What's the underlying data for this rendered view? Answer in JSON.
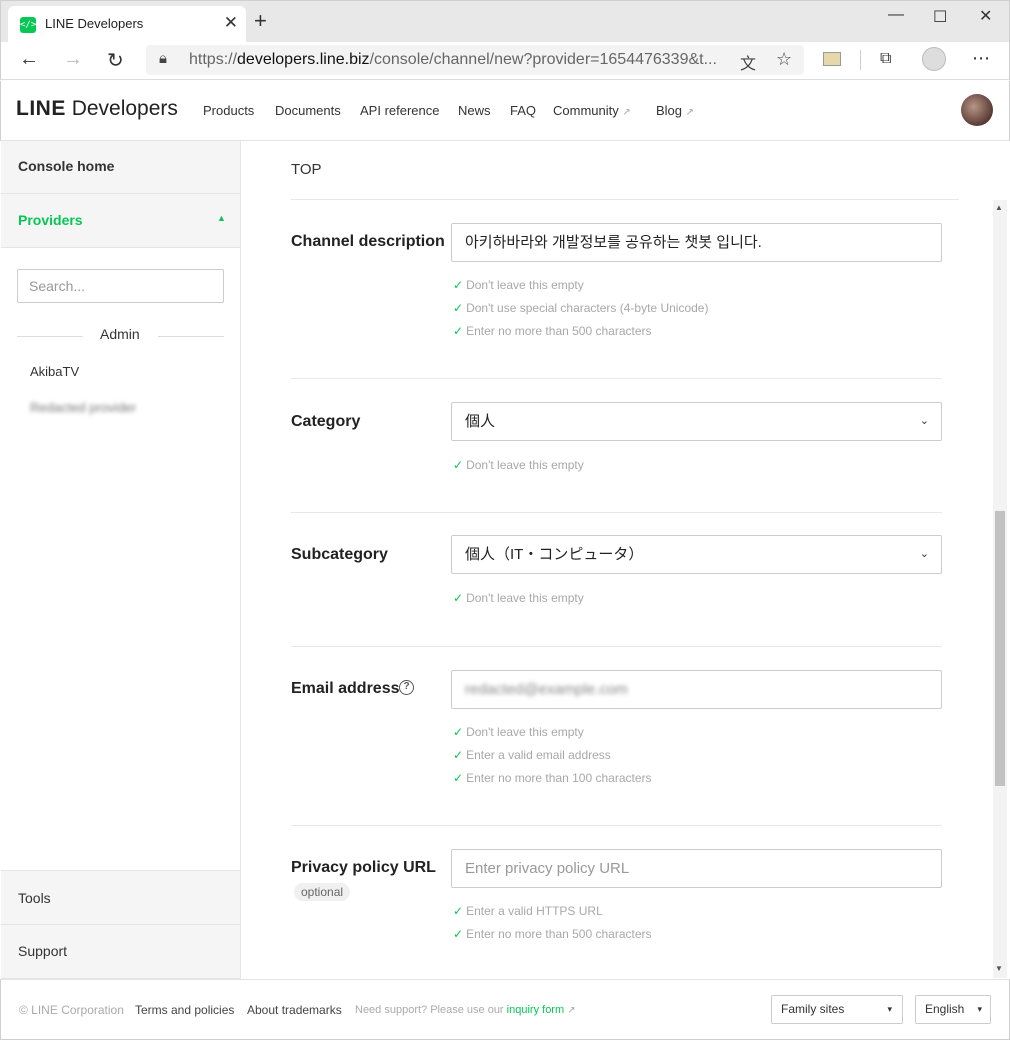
{
  "browser": {
    "tab_title": "LINE Developers",
    "tab_favicon": "</>",
    "url_prefix": "https://",
    "url_host": "developers.line.biz",
    "url_path": "/console/channel/new?provider=1654476339&t..."
  },
  "header": {
    "logo_line": "LINE",
    "logo_dev": "Developers",
    "nav": [
      "Products",
      "Documents",
      "API reference",
      "News",
      "FAQ",
      "Community",
      "Blog"
    ]
  },
  "sidebar": {
    "console_home": "Console home",
    "providers": "Providers",
    "search_placeholder": "Search...",
    "section_title": "Admin",
    "provider_items": [
      "AkibaTV",
      "Redacted provider"
    ],
    "tools": "Tools",
    "support": "Support"
  },
  "main": {
    "breadcrumb": "TOP",
    "fields": {
      "description": {
        "label": "Channel description",
        "value": "아키하바라와 개발정보를 공유하는 챗봇 입니다.",
        "hints": [
          "Don't leave this empty",
          "Don't use special characters (4-byte Unicode)",
          "Enter no more than 500 characters"
        ]
      },
      "category": {
        "label": "Category",
        "value": "個人",
        "hints": [
          "Don't leave this empty"
        ]
      },
      "subcategory": {
        "label": "Subcategory",
        "value": "個人（IT・コンピュータ）",
        "hints": [
          "Don't leave this empty"
        ]
      },
      "email": {
        "label": "Email address",
        "value": "redacted@example.com",
        "hints": [
          "Don't leave this empty",
          "Enter a valid email address",
          "Enter no more than 100 characters"
        ]
      },
      "privacy": {
        "label": "Privacy policy URL",
        "badge": "optional",
        "placeholder": "Enter privacy policy URL",
        "hints": [
          "Enter a valid HTTPS URL",
          "Enter no more than 500 characters"
        ]
      }
    }
  },
  "footer": {
    "copyright": "© LINE Corporation",
    "terms": "Terms and policies",
    "trademarks": "About trademarks",
    "support_text": "Need support? Please use our",
    "inquiry": "inquiry form",
    "family_sites": "Family sites",
    "language": "English"
  },
  "colors": {
    "accent": "#06c755",
    "hint": "#a8a8a8"
  }
}
